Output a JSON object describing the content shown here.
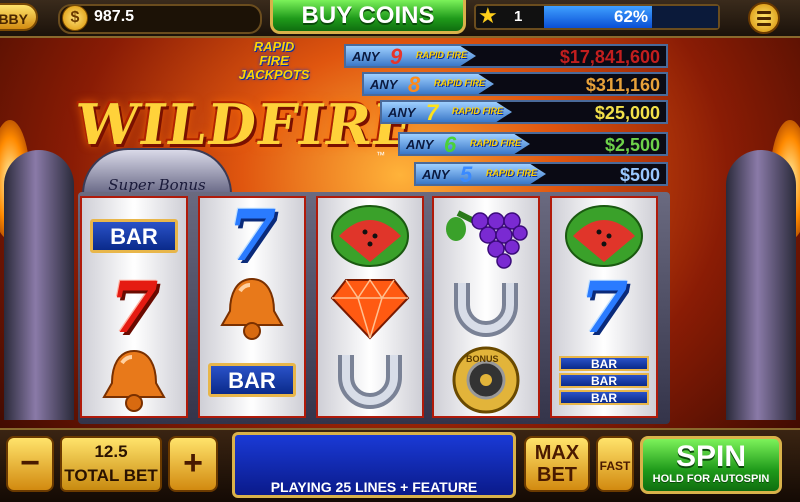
{
  "header": {
    "lobby_label": "BBY",
    "coin_symbol": "$",
    "coin_balance": "987.5",
    "buy_coins_label": "BUY COINS",
    "level": "1",
    "xp_percent": 62,
    "xp_label": "62%"
  },
  "logo": {
    "rapid_fire_lines": [
      "RAPID",
      "FIRE",
      "JACKPOTS"
    ],
    "game_title": "WILDFIRE",
    "trademark": "™",
    "super_bonus": "Super Bonus"
  },
  "jackpots": [
    {
      "any": "ANY",
      "count": "9",
      "rf1": "RAPID",
      "rf2": "FIRE",
      "amount": "$17,841,600",
      "count_color": "#e8352a",
      "amount_color": "#c21e1e"
    },
    {
      "any": "ANY",
      "count": "8",
      "rf1": "RAPID",
      "rf2": "FIRE",
      "amount": "$311,160",
      "count_color": "#ff8a1a",
      "amount_color": "#e8a23a"
    },
    {
      "any": "ANY",
      "count": "7",
      "rf1": "RAPID",
      "rf2": "FIRE",
      "amount": "$25,000",
      "count_color": "#ffe21a",
      "amount_color": "#f2e04a"
    },
    {
      "any": "ANY",
      "count": "6",
      "rf1": "RAPID",
      "rf2": "FIRE",
      "amount": "$2,500",
      "count_color": "#4ad23a",
      "amount_color": "#6ed24a"
    },
    {
      "any": "ANY",
      "count": "5",
      "rf1": "RAPID",
      "rf2": "FIRE",
      "amount": "$500",
      "count_color": "#3a8aff",
      "amount_color": "#9ac8ff"
    }
  ],
  "reels": [
    [
      "bar",
      "red-seven",
      "bell"
    ],
    [
      "blue-seven",
      "bell",
      "bar"
    ],
    [
      "watermelon",
      "diamond",
      "horseshoe"
    ],
    [
      "grapes",
      "horseshoe",
      "bonus-wheel"
    ],
    [
      "watermelon",
      "blue-seven",
      "triple-bar"
    ]
  ],
  "symbol_text": {
    "bar": "BAR",
    "bonus": "BONUS"
  },
  "footer": {
    "minus_label": "−",
    "plus_label": "+",
    "total_bet_value": "12.5",
    "total_bet_label": "TOTAL BET",
    "message": "PLAYING 25 LINES + FEATURE",
    "max_bet_line1": "MAX",
    "max_bet_line2": "BET",
    "fast_label": "FAST",
    "spin_label": "SPIN",
    "spin_sub_label": "HOLD FOR AUTOSPIN"
  },
  "colors": {
    "accent_green": "#1f9a1a",
    "gold": "#d9b24a",
    "reel_border": "#b01a0a"
  }
}
